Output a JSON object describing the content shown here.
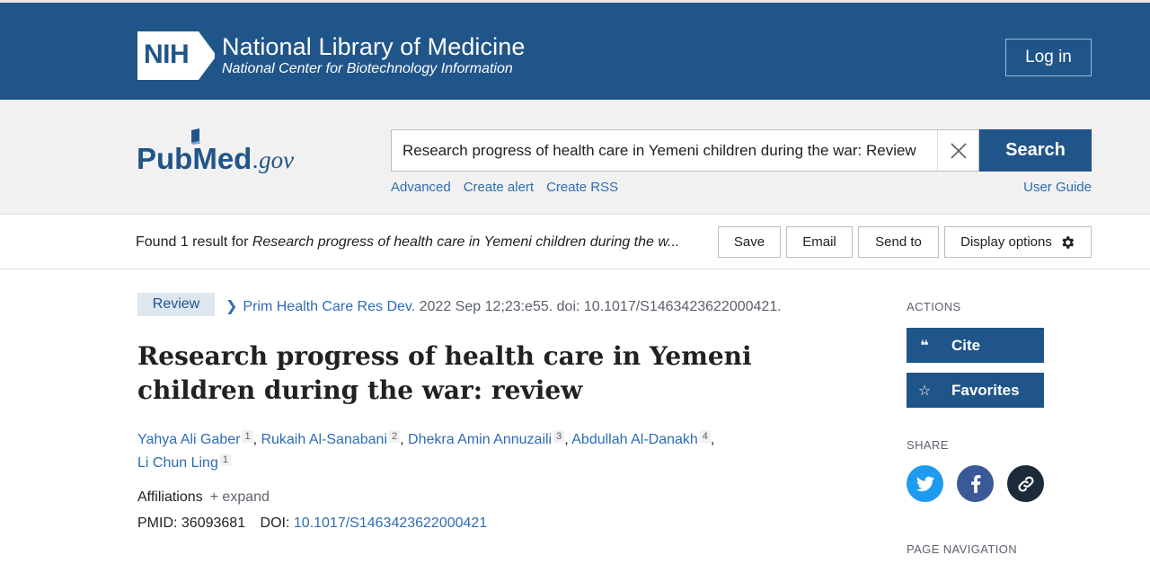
{
  "header": {
    "logo_badge": "NIH",
    "title": "National Library of Medicine",
    "subtitle": "National Center for Biotechnology Information",
    "login_label": "Log in"
  },
  "search": {
    "logo_pub": "Pub",
    "logo_med": "Med",
    "logo_gov": ".gov",
    "query": "Research progress of health care in Yemeni children during the war: Review",
    "button_label": "Search",
    "links": [
      "Advanced",
      "Create alert",
      "Create RSS"
    ],
    "user_guide": "User Guide"
  },
  "results_bar": {
    "found_prefix": "Found 1 result for ",
    "found_query": "Research progress of health care in Yemeni children during the w...",
    "buttons": [
      "Save",
      "Email",
      "Send to",
      "Display options"
    ]
  },
  "article": {
    "type": "Review",
    "journal": "Prim Health Care Res Dev.",
    "citation_rest": " 2022 Sep 12;23:e55. doi: 10.1017/S1463423622000421.",
    "title": "Research progress of health care in Yemeni children during the war: review",
    "authors": [
      {
        "name": "Yahya Ali Gaber",
        "aff": "1"
      },
      {
        "name": "Rukaih Al-Sanabani",
        "aff": "2"
      },
      {
        "name": "Dhekra Amin Annuzaili",
        "aff": "3"
      },
      {
        "name": "Abdullah Al-Danakh",
        "aff": "4"
      },
      {
        "name": "Li Chun Ling",
        "aff": "1"
      }
    ],
    "affiliations_label": "Affiliations",
    "expand_label": "+ expand",
    "pmid_label": "PMID:",
    "pmid": "36093681",
    "doi_label": "DOI:",
    "doi": "10.1017/S1463423622000421"
  },
  "sidebar": {
    "actions_label": "ACTIONS",
    "cite_label": "Cite",
    "favorites_label": "Favorites",
    "share_label": "SHARE",
    "page_nav_label": "PAGE NAVIGATION"
  },
  "colors": {
    "brand": "#20558a",
    "link": "#2d6cb5",
    "twitter": "#1d9bf0",
    "facebook": "#3b5998",
    "permalink": "#1b2b3a"
  }
}
